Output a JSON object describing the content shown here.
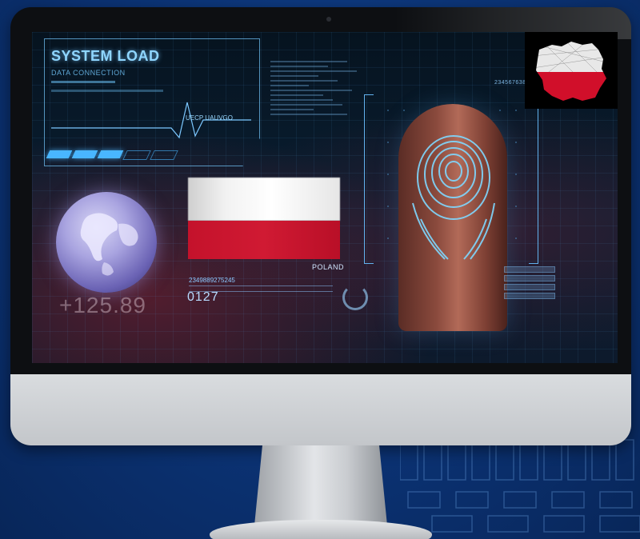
{
  "screen": {
    "system_panel": {
      "title": "SYSTEM LOAD",
      "subtitle": "DATA CONNECTION",
      "tag": "UECP UAUVGO",
      "load_bars_filled": 3,
      "load_bars_total": 5
    },
    "globe_reading": "+125.89",
    "flag": {
      "country_label": "POLAND",
      "top_color": "#ffffff",
      "bottom_color": "#d01a33"
    },
    "codes": {
      "id_line": "2349889275245",
      "big_code": "0127",
      "scan_id": "2345676388"
    }
  },
  "colors": {
    "hud_accent": "#49b6ff",
    "background": "#0b3273"
  },
  "icons": {
    "loading": "spinner-icon",
    "fingerprint": "fingerprint-icon",
    "map": "poland-map-icon",
    "globe": "globe-icon"
  }
}
